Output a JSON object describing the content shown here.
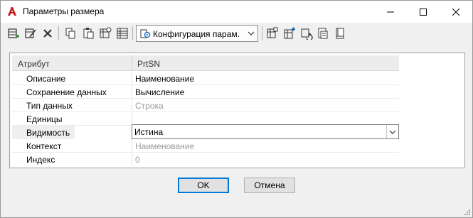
{
  "window": {
    "title": "Параметры размера"
  },
  "toolbar": {
    "config_label": "Конфигурация парам.",
    "icons": [
      "add-row-icon",
      "edit-row-icon",
      "delete-icon",
      "copy-icon",
      "paste-icon",
      "properties-icon",
      "grid-view-icon",
      "config-icon",
      "parameter-icon",
      "parameter-add-icon",
      "refresh-icon",
      "export-icon",
      "book-icon"
    ]
  },
  "grid": {
    "header": {
      "attribute": "Атрибут",
      "value": "PrtSN"
    },
    "rows": [
      {
        "label": "Описание",
        "value": "Наименование",
        "disabled": false
      },
      {
        "label": "Сохранение данных",
        "value": "Вычисление",
        "disabled": false
      },
      {
        "label": "Тип данных",
        "value": "Строка",
        "disabled": true
      },
      {
        "label": "Единицы",
        "value": "",
        "disabled": false
      },
      {
        "label": "Видимость",
        "value": "Истина",
        "disabled": false
      },
      {
        "label": "Контекст",
        "value": "Наименование",
        "disabled": true
      },
      {
        "label": "Индекс",
        "value": "0",
        "disabled": true
      }
    ]
  },
  "buttons": {
    "ok": "OK",
    "cancel": "Отмена"
  }
}
